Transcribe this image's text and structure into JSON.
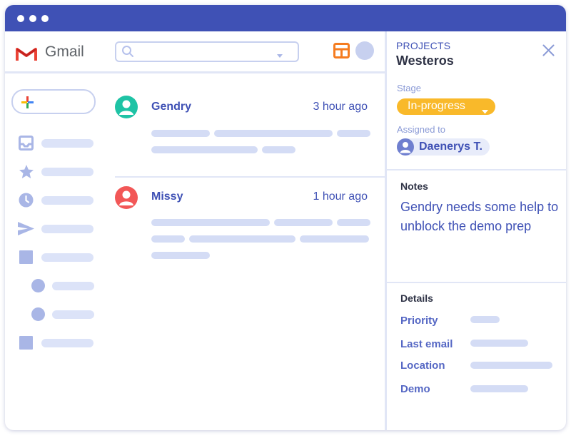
{
  "app": {
    "name": "Gmail",
    "brand_red": "#ea4335",
    "accent": "#3f51b5"
  },
  "icons": {
    "logo": "gmail-m-icon",
    "search": "search-icon",
    "dropdown": "chevron-down-icon",
    "layout": "layout-grid-icon",
    "compose": "plus-icon",
    "close": "close-icon"
  },
  "search": {
    "value": "",
    "placeholder": ""
  },
  "sidebar": {
    "items": [
      {
        "icon": "inbox-icon"
      },
      {
        "icon": "star-icon"
      },
      {
        "icon": "clock-icon"
      },
      {
        "icon": "send-icon"
      },
      {
        "icon": "square-icon"
      },
      {
        "icon": "circle-icon"
      },
      {
        "icon": "circle-icon"
      },
      {
        "icon": "square-icon"
      }
    ]
  },
  "emails": [
    {
      "sender": "Gendry",
      "time": "3 hour ago",
      "avatar_color": "#1ec3a5"
    },
    {
      "sender": "Missy",
      "time": "1 hour ago",
      "avatar_color": "#f25757"
    }
  ],
  "panel": {
    "section_label": "PROJECTS",
    "project_name": "Westeros",
    "stage_label": "Stage",
    "stage_value": "In-progress",
    "stage_color": "#f9b92a",
    "assigned_label": "Assigned to",
    "assignee": "Daenerys T.",
    "notes_title": "Notes",
    "notes_text": "Gendry needs some help to unblock the demo prep",
    "details_title": "Details",
    "details": [
      {
        "label": "Priority"
      },
      {
        "label": "Last email"
      },
      {
        "label": "Location"
      },
      {
        "label": "Demo"
      }
    ]
  }
}
